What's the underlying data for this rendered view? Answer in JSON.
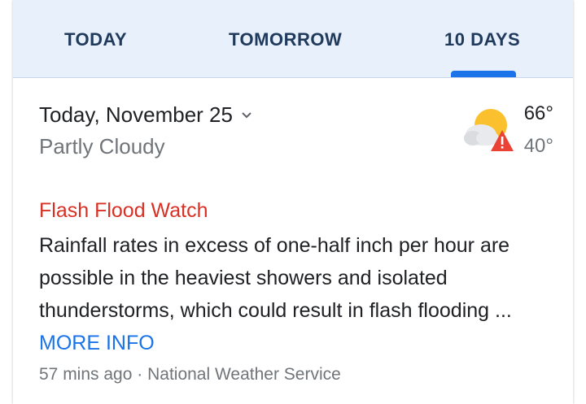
{
  "tabs": [
    {
      "label": "TODAY"
    },
    {
      "label": "TOMORROW"
    },
    {
      "label": "10 DAYS"
    }
  ],
  "selected_tab": "10 DAYS",
  "forecast": {
    "date_title": "Today, November 25",
    "condition": "Partly Cloudy",
    "temp_high": "66°",
    "temp_low": "40°",
    "icon": "partly-cloudy-icon",
    "warning_icon": "warning-triangle-icon"
  },
  "alert": {
    "title": "Flash Flood Watch",
    "body": "Rainfall rates in excess of one-half inch per hour are possible in the heaviest showers and isolated thunderstorms, which could result in flash flooding ...",
    "more_info_label": "MORE INFO",
    "age": "57 mins ago",
    "separator": "·",
    "source": "National Weather Service"
  },
  "colors": {
    "accent": "#1a73e8",
    "alert": "#d93025",
    "tab_bg": "#e8f0fc"
  }
}
